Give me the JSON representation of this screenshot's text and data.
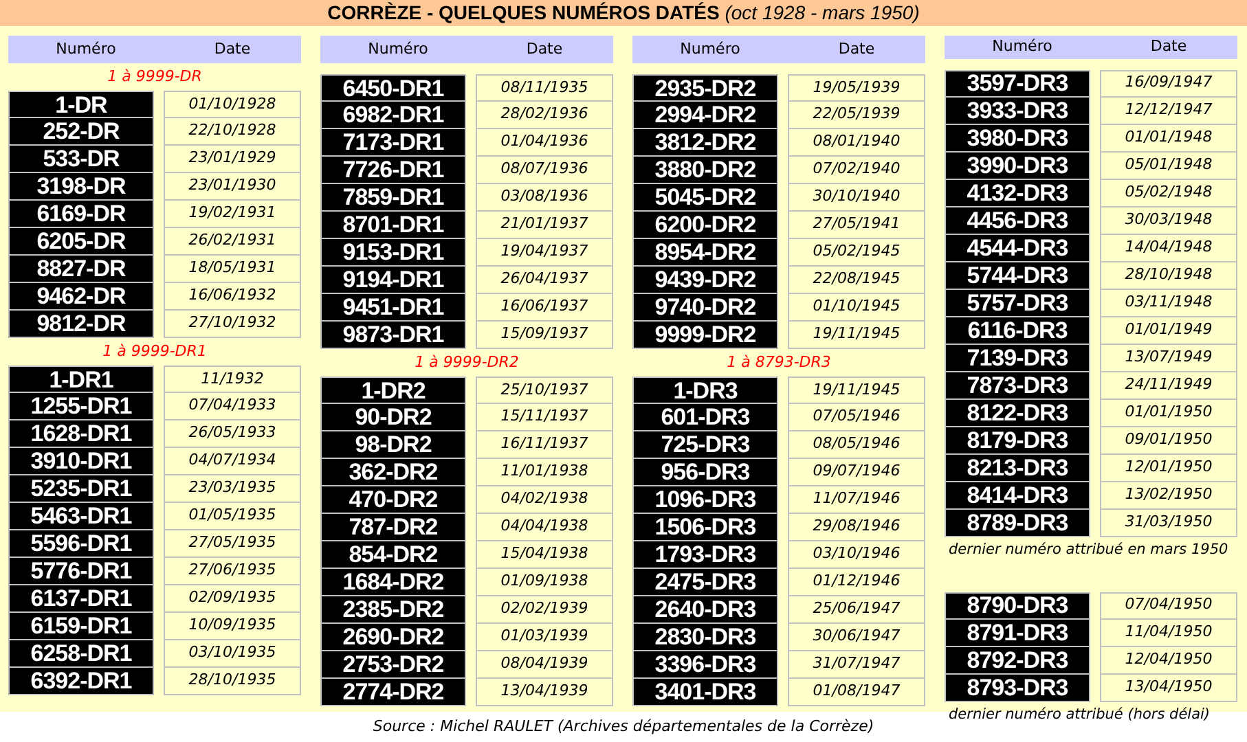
{
  "title": "**CORRÈZE - QUELQUES NUMÉROS DATÉS** *(oct 1928 - mars 1950)*",
  "columns": [
    {
      "headers": [
        "Numéro",
        "Date"
      ],
      "sections": [
        {
          "range": "1 à 9999-DR",
          "rows": [
            [
              "1-DR",
              "01/10/1928"
            ],
            [
              "252-DR",
              "22/10/1928"
            ],
            [
              "533-DR",
              "23/01/1929"
            ],
            [
              "3198-DR",
              "23/01/1930"
            ],
            [
              "6169-DR",
              "19/02/1931"
            ],
            [
              "6205-DR",
              "26/02/1931"
            ],
            [
              "8827-DR",
              "18/05/1931"
            ],
            [
              "9462-DR",
              "16/06/1932"
            ],
            [
              "9812-DR",
              "27/10/1932"
            ]
          ]
        },
        {
          "range": "1 à 9999-DR1",
          "rows": [
            [
              "1-DR1",
              "11/1932"
            ],
            [
              "1255-DR1",
              "07/04/1933"
            ],
            [
              "1628-DR1",
              "26/05/1933"
            ],
            [
              "3910-DR1",
              "04/07/1934"
            ],
            [
              "5235-DR1",
              "23/03/1935"
            ],
            [
              "5463-DR1",
              "01/05/1935"
            ],
            [
              "5596-DR1",
              "27/05/1935"
            ],
            [
              "5776-DR1",
              "27/06/1935"
            ],
            [
              "6137-DR1",
              "02/09/1935"
            ],
            [
              "6159-DR1",
              "10/09/1935"
            ],
            [
              "6258-DR1",
              "03/10/1935"
            ],
            [
              "6392-DR1",
              "28/10/1935"
            ]
          ]
        }
      ]
    },
    {
      "headers": [
        "Numéro",
        "Date"
      ],
      "sections": [
        {
          "rows": [
            [
              "6450-DR1",
              "08/11/1935"
            ],
            [
              "6982-DR1",
              "28/02/1936"
            ],
            [
              "7173-DR1",
              "01/04/1936"
            ],
            [
              "7726-DR1",
              "08/07/1936"
            ],
            [
              "7859-DR1",
              "03/08/1936"
            ],
            [
              "8701-DR1",
              "21/01/1937"
            ],
            [
              "9153-DR1",
              "19/04/1937"
            ],
            [
              "9194-DR1",
              "26/04/1937"
            ],
            [
              "9451-DR1",
              "16/06/1937"
            ],
            [
              "9873-DR1",
              "15/09/1937"
            ]
          ]
        },
        {
          "range": "1 à 9999-DR2",
          "rows": [
            [
              "1-DR2",
              "25/10/1937"
            ],
            [
              "90-DR2",
              "15/11/1937"
            ],
            [
              "98-DR2",
              "16/11/1937"
            ],
            [
              "362-DR2",
              "11/01/1938"
            ],
            [
              "470-DR2",
              "04/02/1938"
            ],
            [
              "787-DR2",
              "04/04/1938"
            ],
            [
              "854-DR2",
              "15/04/1938"
            ],
            [
              "1684-DR2",
              "01/09/1938"
            ],
            [
              "2385-DR2",
              "02/02/1939"
            ],
            [
              "2690-DR2",
              "01/03/1939"
            ],
            [
              "2753-DR2",
              "08/04/1939"
            ],
            [
              "2774-DR2",
              "13/04/1939"
            ]
          ]
        }
      ]
    },
    {
      "headers": [
        "Numéro",
        "Date"
      ],
      "sections": [
        {
          "rows": [
            [
              "2935-DR2",
              "19/05/1939"
            ],
            [
              "2994-DR2",
              "22/05/1939"
            ],
            [
              "3812-DR2",
              "08/01/1940"
            ],
            [
              "3880-DR2",
              "07/02/1940"
            ],
            [
              "5045-DR2",
              "30/10/1940"
            ],
            [
              "6200-DR2",
              "27/05/1941"
            ],
            [
              "8954-DR2",
              "05/02/1945"
            ],
            [
              "9439-DR2",
              "22/08/1945"
            ],
            [
              "9740-DR2",
              "01/10/1945"
            ],
            [
              "9999-DR2",
              "19/11/1945"
            ]
          ]
        },
        {
          "range": "1 à 8793-DR3",
          "rows": [
            [
              "1-DR3",
              "19/11/1945"
            ],
            [
              "601-DR3",
              "07/05/1946"
            ],
            [
              "725-DR3",
              "08/05/1946"
            ],
            [
              "956-DR3",
              "09/07/1946"
            ],
            [
              "1096-DR3",
              "11/07/1946"
            ],
            [
              "1506-DR3",
              "29/08/1946"
            ],
            [
              "1793-DR3",
              "03/10/1946"
            ],
            [
              "2475-DR3",
              "01/12/1946"
            ],
            [
              "2640-DR3",
              "25/06/1947"
            ],
            [
              "2830-DR3",
              "30/06/1947"
            ],
            [
              "3396-DR3",
              "31/07/1947"
            ],
            [
              "3401-DR3",
              "01/08/1947"
            ]
          ]
        }
      ]
    },
    {
      "headers": [
        "Numéro",
        "Date"
      ],
      "sections": [
        {
          "rows": [
            [
              "3597-DR3",
              "16/09/1947"
            ],
            [
              "3933-DR3",
              "12/12/1947"
            ],
            [
              "3980-DR3",
              "01/01/1948"
            ],
            [
              "3990-DR3",
              "05/01/1948"
            ],
            [
              "4132-DR3",
              "05/02/1948"
            ],
            [
              "4456-DR3",
              "30/03/1948"
            ],
            [
              "4544-DR3",
              "14/04/1948"
            ],
            [
              "5744-DR3",
              "28/10/1948"
            ],
            [
              "5757-DR3",
              "03/11/1948"
            ],
            [
              "6116-DR3",
              "01/01/1949"
            ],
            [
              "7139-DR3",
              "13/07/1949"
            ],
            [
              "7873-DR3",
              "24/11/1949"
            ],
            [
              "8122-DR3",
              "01/01/1950"
            ],
            [
              "8179-DR3",
              "09/01/1950"
            ],
            [
              "8213-DR3",
              "12/01/1950"
            ],
            [
              "8414-DR3",
              "13/02/1950"
            ],
            [
              "8789-DR3",
              "31/03/1950"
            ]
          ],
          "note": "dernier numéro attribué en mars 1950"
        },
        {
          "rows": [
            [
              "8790-DR3",
              "07/04/1950"
            ],
            [
              "8791-DR3",
              "11/04/1950"
            ],
            [
              "8792-DR3",
              "12/04/1950"
            ],
            [
              "8793-DR3",
              "13/04/1950"
            ]
          ],
          "note": "dernier numéro attribué (hors délai)"
        }
      ]
    }
  ],
  "source": "Source : Michel RAULET (Archives départementales de la Corrèze)"
}
